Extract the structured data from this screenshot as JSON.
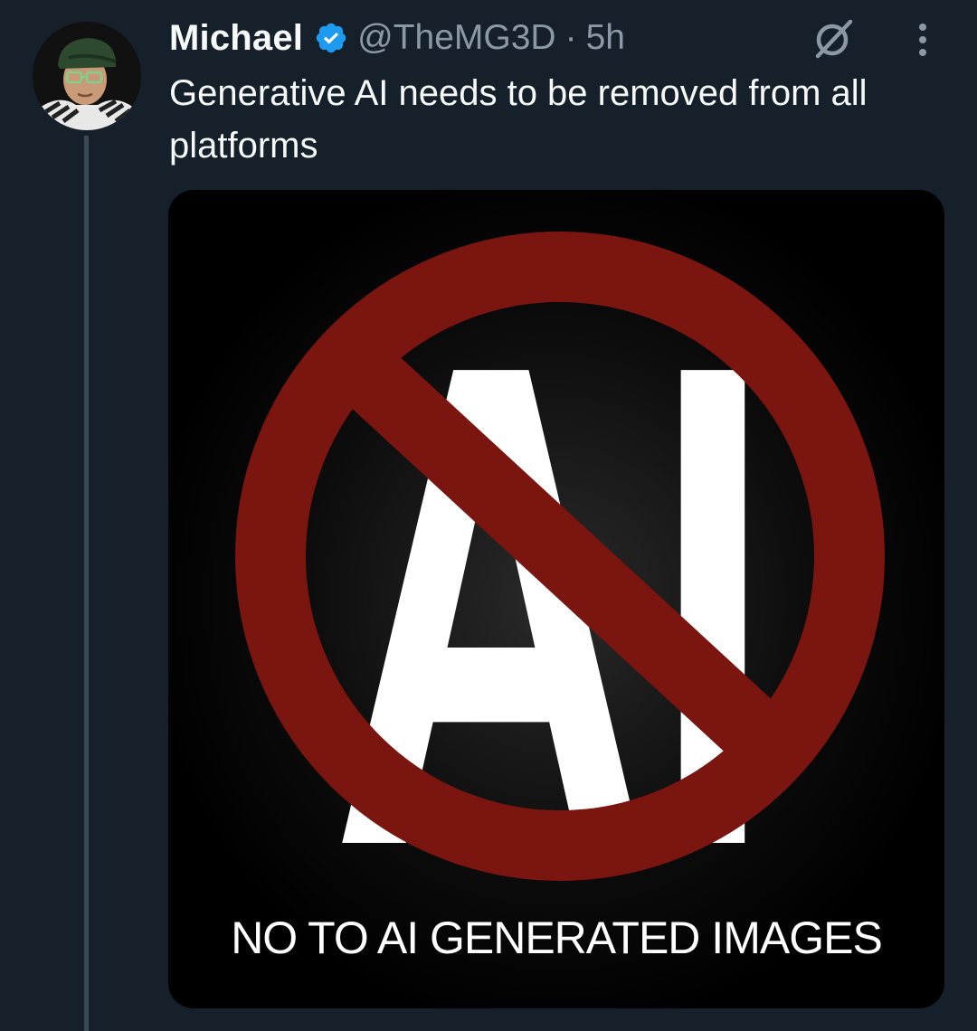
{
  "tweet": {
    "author": {
      "name": "Michael",
      "verified": true,
      "handle": "@TheMG3D",
      "separator": "·",
      "time": "5h"
    },
    "text": "Generative AI needs to be removed from all platforms",
    "media": {
      "big_letters": "AI",
      "caption": "NO TO AI GENERATED IMAGES",
      "symbol_color": "#7a1510"
    }
  },
  "icons": {
    "verified": "verified-badge-icon",
    "grok": "grok-icon",
    "more": "more-options-icon"
  },
  "colors": {
    "background": "#15202b",
    "text_primary": "#f7f9f9",
    "text_secondary": "#8b98a5",
    "verified_blue": "#1d9bf0"
  }
}
